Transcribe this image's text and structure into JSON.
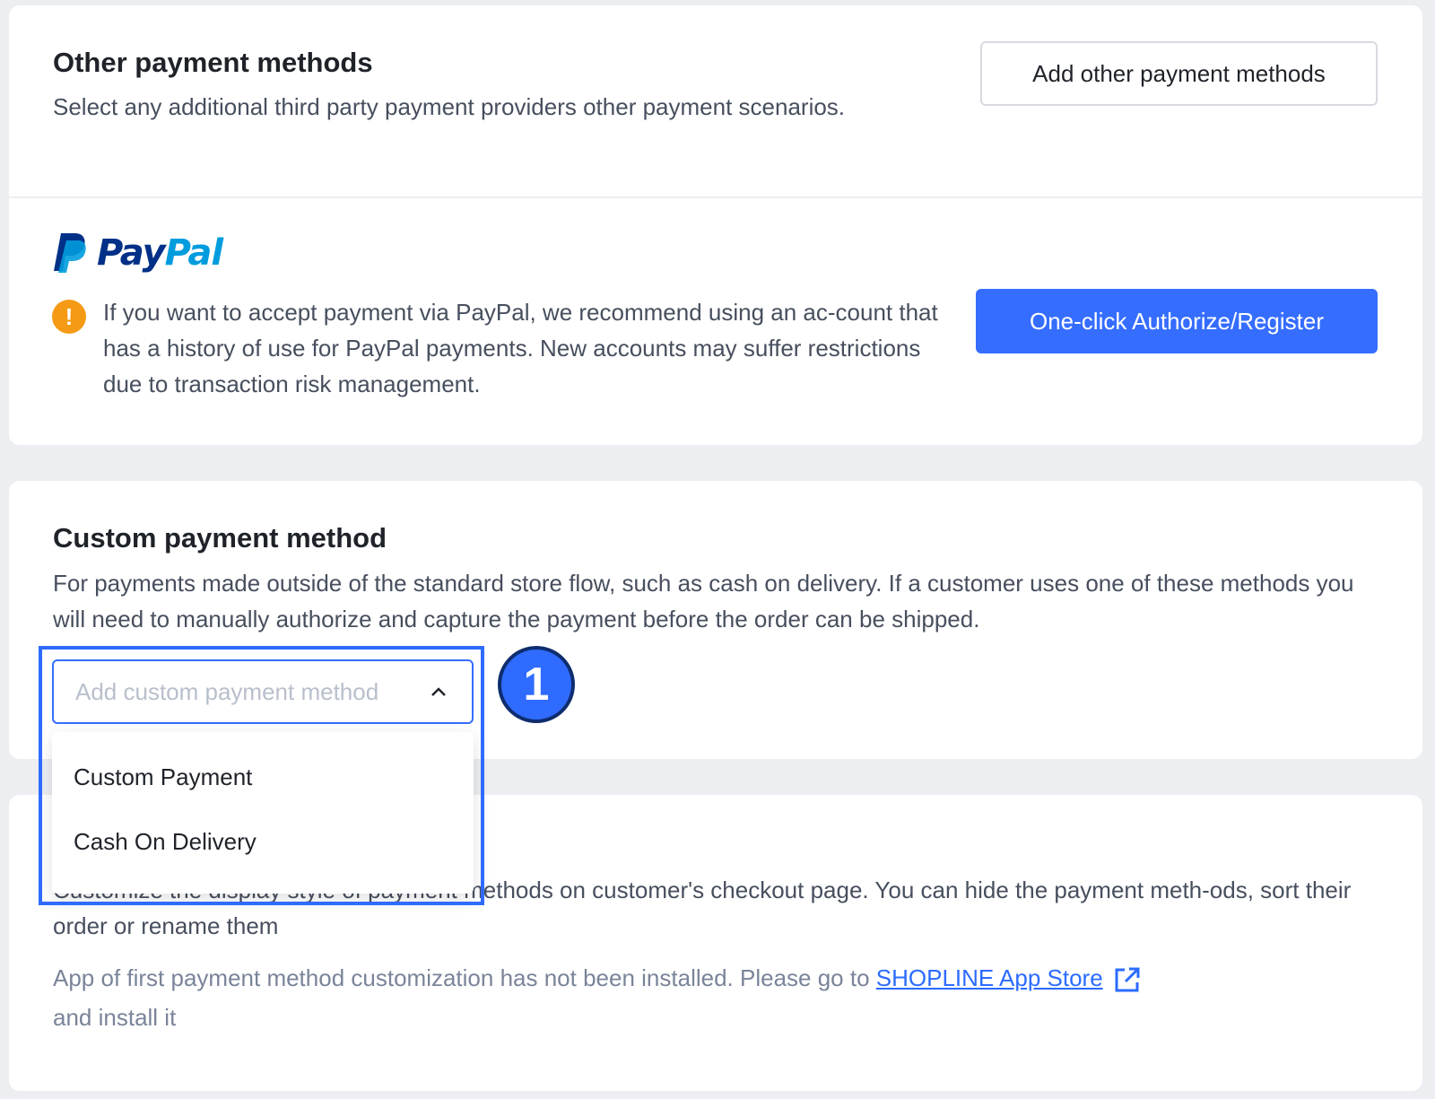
{
  "other_methods": {
    "title": "Other payment methods",
    "description": "Select any additional third party payment providers other payment scenarios.",
    "add_button": "Add other payment methods"
  },
  "paypal": {
    "logo_text_pay": "Pay",
    "logo_text_pal": "Pal",
    "warning": "If you want to accept payment via PayPal, we recommend using an ac-count that has a history of use for PayPal payments. New accounts may suffer restrictions due to transaction risk management.",
    "authorize_button": "One-click Authorize/Register",
    "brand_colors": {
      "dark": "#003087",
      "light": "#009cde"
    }
  },
  "custom_method": {
    "title": "Custom payment method",
    "description": "For payments made outside of the standard store flow, such as cash on delivery. If a customer uses one of these methods you will need to manually authorize and capture the payment before the order can be shipped.",
    "select_placeholder": "Add custom payment method",
    "options": [
      "Custom Payment",
      "Cash On Delivery"
    ]
  },
  "display_style": {
    "description": "Customize the display style of payment methods on customer's checkout page. You can hide the payment meth-ods, sort their order or rename them",
    "notice_before": "App of first payment method customization has not been installed. Please go to ",
    "link_text": "SHOPLINE App Store",
    "notice_after": "and install it"
  },
  "annotation": {
    "step_number": "1"
  },
  "colors": {
    "accent": "#356dff",
    "warning": "#f59a14",
    "highlight": "#2f6bff"
  }
}
